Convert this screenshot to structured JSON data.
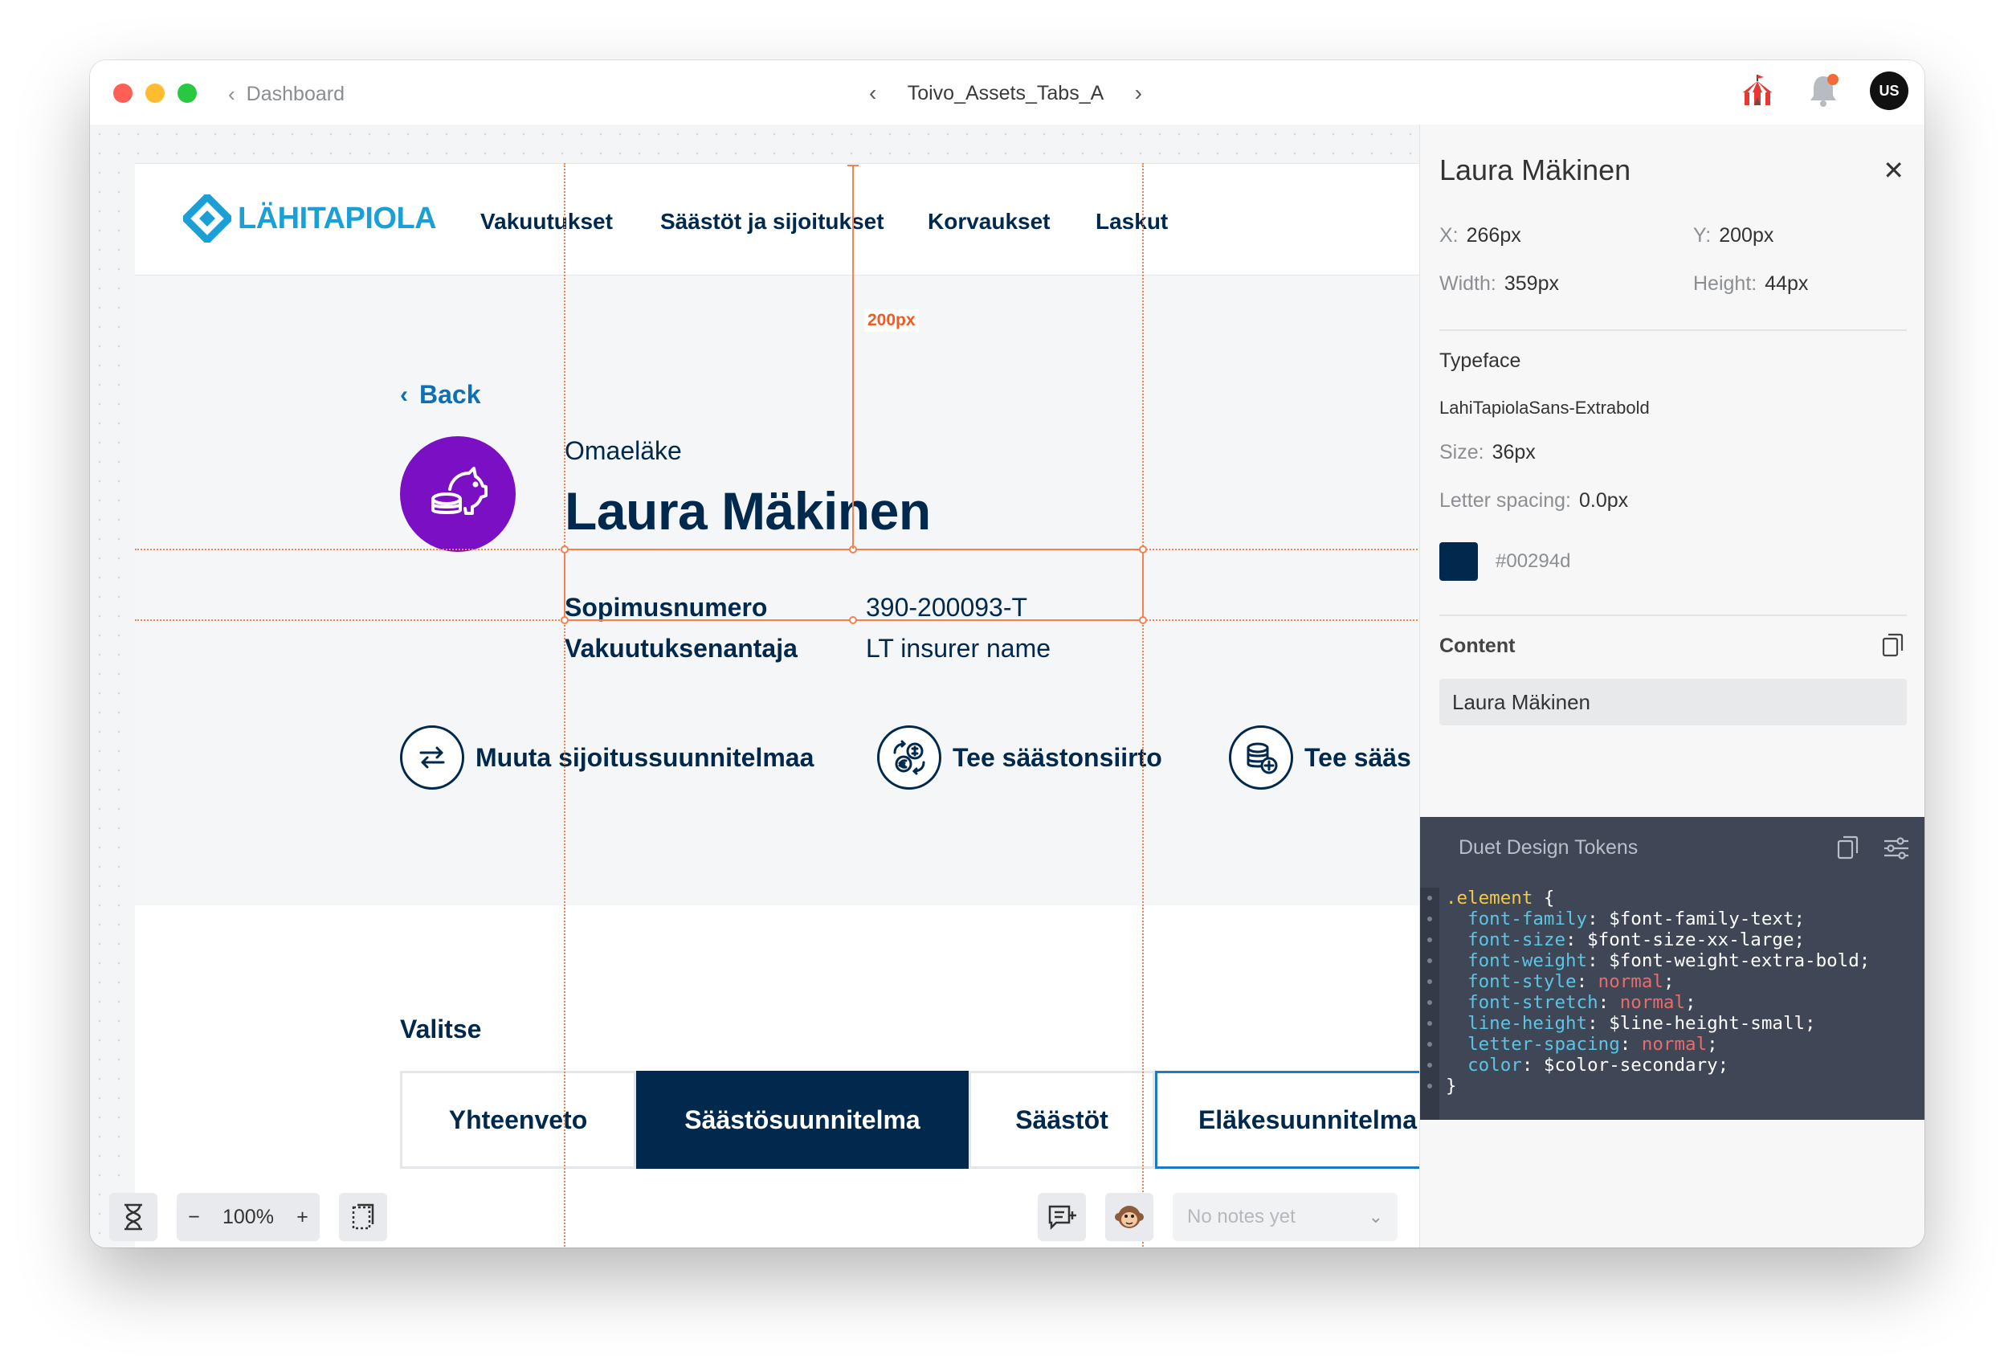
{
  "titlebar": {
    "breadcrumb": "Dashboard",
    "document_name": "Toivo_Assets_Tabs_A",
    "avatar_initials": "US"
  },
  "site": {
    "logo_text": "LÄHITAPIOLA",
    "nav": [
      "Vakuutukset",
      "Säästöt ja sijoitukset",
      "Korvaukset",
      "Laskut"
    ],
    "back_label": "Back",
    "subtitle": "Omaeläke",
    "heading": "Laura Mäkinen",
    "info": [
      {
        "label": "Sopimusnumero",
        "value": "390-200093-T"
      },
      {
        "label": "Vakuutuksenantaja",
        "value": "LT insurer name"
      }
    ],
    "actions": [
      "Muuta sijoitussuunnitelmaa",
      "Tee säästonsiirto",
      "Tee sääs"
    ],
    "select_label": "Valitse",
    "tabs": [
      "Yhteenveto",
      "Säästösuunnitelma",
      "Säästöt",
      "Eläkesuunnitelma"
    ],
    "active_tab": "Säästösuunnitelma"
  },
  "measure": {
    "distance_label": "200px"
  },
  "toolbar": {
    "zoom": "100%",
    "notes_placeholder": "No notes yet"
  },
  "inspector": {
    "title": "Laura Mäkinen",
    "x": {
      "label": "X:",
      "value": "266px"
    },
    "y": {
      "label": "Y:",
      "value": "200px"
    },
    "width": {
      "label": "Width:",
      "value": "359px"
    },
    "height": {
      "label": "Height:",
      "value": "44px"
    },
    "typeface_label": "Typeface",
    "typeface_value": "LahiTapiolaSans-Extrabold",
    "size": {
      "label": "Size:",
      "value": "36px"
    },
    "letter_spacing": {
      "label": "Letter spacing:",
      "value": "0.0px"
    },
    "color_hex": "#00294d",
    "content_label": "Content",
    "content_value": "Laura Mäkinen",
    "tokens_title": "Duet Design Tokens",
    "code": {
      "selector": ".element",
      "open": " {",
      "close": "}",
      "lines": [
        {
          "prop": "font-family",
          "value": "$font-family-text",
          "kw": false
        },
        {
          "prop": "font-size",
          "value": "$font-size-xx-large",
          "kw": false
        },
        {
          "prop": "font-weight",
          "value": "$font-weight-extra-bold",
          "kw": false
        },
        {
          "prop": "font-style",
          "value": "normal",
          "kw": true
        },
        {
          "prop": "font-stretch",
          "value": "normal",
          "kw": true
        },
        {
          "prop": "line-height",
          "value": "$line-height-small",
          "kw": false
        },
        {
          "prop": "letter-spacing",
          "value": "normal",
          "kw": true
        },
        {
          "prop": "color",
          "value": "$color-secondary",
          "kw": false
        }
      ]
    }
  },
  "colors": {
    "brand_blue": "#1a9fd6",
    "secondary": "#00294d",
    "purple": "#7b0fc4",
    "guide_orange": "#f3824e"
  }
}
